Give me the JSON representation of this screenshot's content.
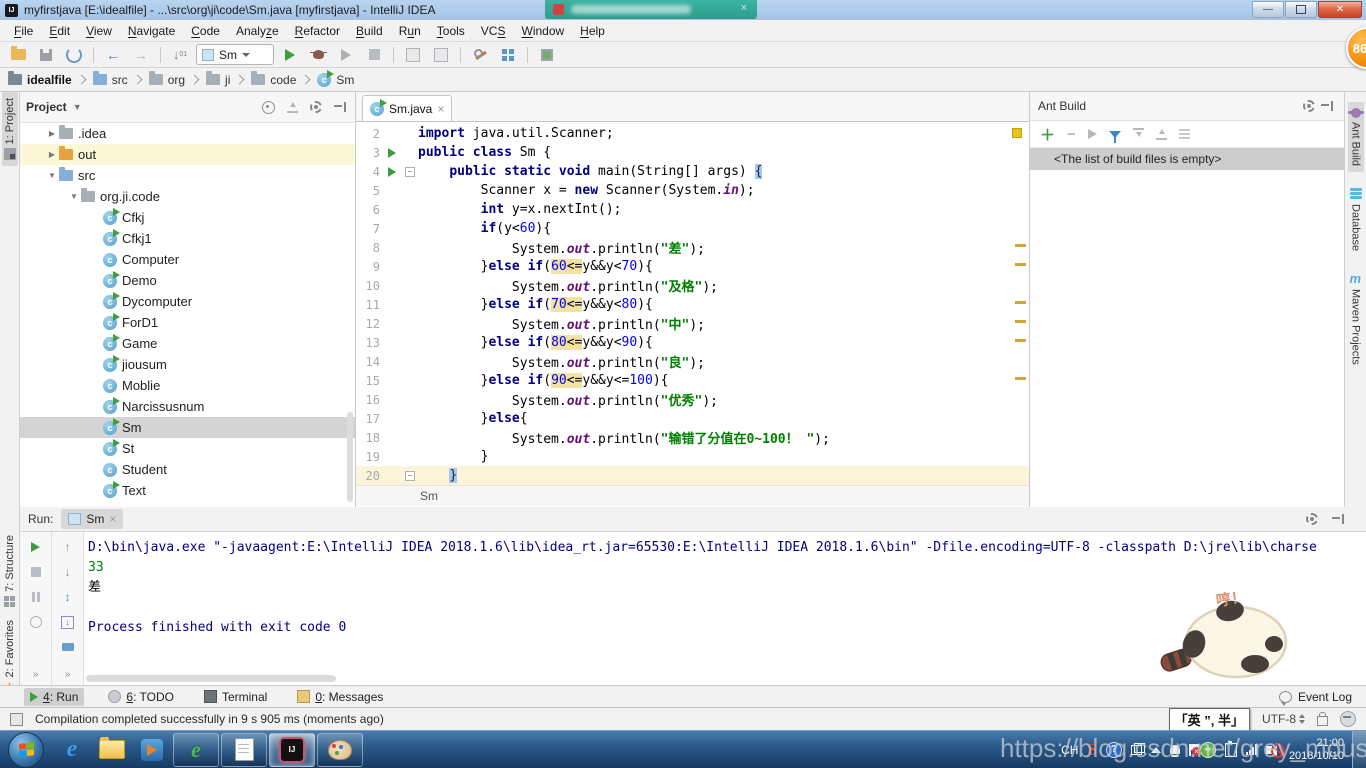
{
  "window": {
    "title": "myfirstjava [E:\\idealfile] - ...\\src\\org\\ji\\code\\Sm.java [myfirstjava] - IntelliJ IDEA",
    "badge": "86"
  },
  "menu": {
    "items": [
      {
        "label": "File",
        "m": 0
      },
      {
        "label": "Edit",
        "m": 0
      },
      {
        "label": "View",
        "m": 0
      },
      {
        "label": "Navigate",
        "m": 0
      },
      {
        "label": "Code",
        "m": 0
      },
      {
        "label": "Analyze",
        "m": 5
      },
      {
        "label": "Refactor",
        "m": 0
      },
      {
        "label": "Build",
        "m": 0
      },
      {
        "label": "Run",
        "m": 1
      },
      {
        "label": "Tools",
        "m": 0
      },
      {
        "label": "VCS",
        "m": 2
      },
      {
        "label": "Window",
        "m": 0
      },
      {
        "label": "Help",
        "m": 0
      }
    ]
  },
  "toolbar": {
    "run_config": "Sm"
  },
  "breadcrumbs": {
    "items": [
      {
        "label": "idealfile",
        "icon": "module"
      },
      {
        "label": "src",
        "icon": "folder-blue"
      },
      {
        "label": "org",
        "icon": "folder-gray"
      },
      {
        "label": "ji",
        "icon": "folder-gray"
      },
      {
        "label": "code",
        "icon": "folder-gray"
      },
      {
        "label": "Sm",
        "icon": "class"
      }
    ]
  },
  "left_strip": {
    "tabs": [
      {
        "label": "1: Project",
        "icon": "project",
        "selected": true
      },
      {
        "label": "7: Structure",
        "icon": "structure",
        "selected": false
      },
      {
        "label": "2: Favorites",
        "icon": "favorites",
        "selected": false
      }
    ]
  },
  "right_strip": {
    "tabs": [
      {
        "label": "Ant Build",
        "icon": "ant",
        "selected": true
      },
      {
        "label": "Database",
        "icon": "database",
        "selected": false
      },
      {
        "label": "Maven Projects",
        "icon": "maven",
        "selected": false
      }
    ]
  },
  "project_panel": {
    "title": "Project",
    "tree": [
      {
        "label": ".idea",
        "type": "folder",
        "color": "gray",
        "arrow": "right",
        "indent": 1
      },
      {
        "label": "out",
        "type": "folder",
        "color": "orange",
        "arrow": "right",
        "indent": 1,
        "highlight": true
      },
      {
        "label": "src",
        "type": "folder",
        "color": "blue",
        "arrow": "down",
        "indent": 1
      },
      {
        "label": "org.ji.code",
        "type": "folder",
        "color": "gray",
        "arrow": "down",
        "indent": 2
      },
      {
        "label": "Cfkj",
        "type": "class",
        "run": true,
        "indent": 3
      },
      {
        "label": "Cfkj1",
        "type": "class",
        "run": true,
        "indent": 3
      },
      {
        "label": "Computer",
        "type": "class",
        "run": false,
        "indent": 3
      },
      {
        "label": "Demo",
        "type": "class",
        "run": true,
        "indent": 3
      },
      {
        "label": "Dycomputer",
        "type": "class",
        "run": true,
        "indent": 3
      },
      {
        "label": "ForD1",
        "type": "class",
        "run": true,
        "indent": 3
      },
      {
        "label": "Game",
        "type": "class",
        "run": true,
        "indent": 3
      },
      {
        "label": "jiousum",
        "type": "class",
        "run": true,
        "indent": 3
      },
      {
        "label": "Moblie",
        "type": "class",
        "run": false,
        "indent": 3
      },
      {
        "label": "Narcissusnum",
        "type": "class",
        "run": true,
        "indent": 3
      },
      {
        "label": "Sm",
        "type": "class",
        "run": true,
        "indent": 3,
        "selected": true
      },
      {
        "label": "St",
        "type": "class",
        "run": true,
        "indent": 3
      },
      {
        "label": "Student",
        "type": "class",
        "run": false,
        "indent": 3
      },
      {
        "label": "Text",
        "type": "class",
        "run": true,
        "indent": 3
      }
    ]
  },
  "editor": {
    "tab": "Sm.java",
    "breadcrumb": "Sm",
    "marks_lines": [
      8,
      9,
      11,
      12,
      13,
      15
    ],
    "lines": [
      {
        "n": 2,
        "seg": [
          [
            "kw",
            "import"
          ],
          [
            "pl",
            " java.util.Scanner;"
          ]
        ]
      },
      {
        "n": 3,
        "run": true,
        "seg": [
          [
            "kw",
            "public class"
          ],
          [
            "pl",
            " Sm {"
          ]
        ]
      },
      {
        "n": 4,
        "run": true,
        "fold": true,
        "seg": [
          [
            "pl",
            "    "
          ],
          [
            "kw",
            "public static void"
          ],
          [
            "pl",
            " main(String[] args) "
          ],
          [
            "brc",
            "{"
          ]
        ]
      },
      {
        "n": 5,
        "seg": [
          [
            "pl",
            "        Scanner x = "
          ],
          [
            "kw",
            "new"
          ],
          [
            "pl",
            " Scanner(System."
          ],
          [
            "fld",
            "in"
          ],
          [
            "pl",
            ");"
          ]
        ]
      },
      {
        "n": 6,
        "seg": [
          [
            "pl",
            "        "
          ],
          [
            "kw",
            "int"
          ],
          [
            "pl",
            " y=x.nextInt();"
          ]
        ]
      },
      {
        "n": 7,
        "seg": [
          [
            "pl",
            "        "
          ],
          [
            "kw",
            "if"
          ],
          [
            "pl",
            "(y<"
          ],
          [
            "num",
            "60"
          ],
          [
            "pl",
            "){"
          ]
        ]
      },
      {
        "n": 8,
        "seg": [
          [
            "pl",
            "            System."
          ],
          [
            "fld",
            "out"
          ],
          [
            "pl",
            ".println("
          ],
          [
            "str",
            "\"差\""
          ],
          [
            "pl",
            ");"
          ]
        ]
      },
      {
        "n": 9,
        "seg": [
          [
            "pl",
            "        }"
          ],
          [
            "kw",
            "else"
          ],
          [
            "pl",
            " "
          ],
          [
            "kw",
            "if"
          ],
          [
            "pl",
            "("
          ],
          [
            "numh",
            "60"
          ],
          [
            "plh",
            "<="
          ],
          [
            "pl",
            "y&&y<"
          ],
          [
            "num",
            "70"
          ],
          [
            "pl",
            "){"
          ]
        ]
      },
      {
        "n": 10,
        "seg": [
          [
            "pl",
            "            System."
          ],
          [
            "fld",
            "out"
          ],
          [
            "pl",
            ".println("
          ],
          [
            "str",
            "\"及格\""
          ],
          [
            "pl",
            ");"
          ]
        ]
      },
      {
        "n": 11,
        "seg": [
          [
            "pl",
            "        }"
          ],
          [
            "kw",
            "else"
          ],
          [
            "pl",
            " "
          ],
          [
            "kw",
            "if"
          ],
          [
            "pl",
            "("
          ],
          [
            "numh",
            "70"
          ],
          [
            "plh",
            "<="
          ],
          [
            "pl",
            "y&&y<"
          ],
          [
            "num",
            "80"
          ],
          [
            "pl",
            "){"
          ]
        ]
      },
      {
        "n": 12,
        "seg": [
          [
            "pl",
            "            System."
          ],
          [
            "fld",
            "out"
          ],
          [
            "pl",
            ".println("
          ],
          [
            "str",
            "\"中\""
          ],
          [
            "pl",
            ");"
          ]
        ]
      },
      {
        "n": 13,
        "seg": [
          [
            "pl",
            "        }"
          ],
          [
            "kw",
            "else"
          ],
          [
            "pl",
            " "
          ],
          [
            "kw",
            "if"
          ],
          [
            "pl",
            "("
          ],
          [
            "numh",
            "80"
          ],
          [
            "plh",
            "<="
          ],
          [
            "pl",
            "y&&y<"
          ],
          [
            "num",
            "90"
          ],
          [
            "pl",
            "){"
          ]
        ]
      },
      {
        "n": 14,
        "seg": [
          [
            "pl",
            "            System."
          ],
          [
            "fld",
            "out"
          ],
          [
            "pl",
            ".println("
          ],
          [
            "str",
            "\"良\""
          ],
          [
            "pl",
            ");"
          ]
        ]
      },
      {
        "n": 15,
        "seg": [
          [
            "pl",
            "        }"
          ],
          [
            "kw",
            "else"
          ],
          [
            "pl",
            " "
          ],
          [
            "kw",
            "if"
          ],
          [
            "pl",
            "("
          ],
          [
            "numh",
            "90"
          ],
          [
            "plh",
            "<="
          ],
          [
            "pl",
            "y&&y<="
          ],
          [
            "num",
            "100"
          ],
          [
            "pl",
            "){"
          ]
        ]
      },
      {
        "n": 16,
        "seg": [
          [
            "pl",
            "            System."
          ],
          [
            "fld",
            "out"
          ],
          [
            "pl",
            ".println("
          ],
          [
            "str",
            "\"优秀\""
          ],
          [
            "pl",
            ");"
          ]
        ]
      },
      {
        "n": 17,
        "seg": [
          [
            "pl",
            "        }"
          ],
          [
            "kw",
            "else"
          ],
          [
            "pl",
            "{"
          ]
        ]
      },
      {
        "n": 18,
        "seg": [
          [
            "pl",
            "            System."
          ],
          [
            "fld",
            "out"
          ],
          [
            "pl",
            ".println("
          ],
          [
            "str",
            "\"输错了分值在0~100！ \""
          ],
          [
            "pl",
            ");"
          ]
        ]
      },
      {
        "n": 19,
        "seg": [
          [
            "pl",
            "        }"
          ]
        ]
      },
      {
        "n": 20,
        "cur": true,
        "fold": true,
        "seg": [
          [
            "pl",
            "    "
          ],
          [
            "brc",
            "}"
          ]
        ]
      }
    ]
  },
  "ant_panel": {
    "title": "Ant Build",
    "empty_text": "<The list of build files is empty>"
  },
  "run_panel": {
    "label": "Run:",
    "tab": "Sm",
    "console": [
      {
        "style": "sys",
        "text": "D:\\bin\\java.exe \"-javaagent:E:\\IntelliJ IDEA 2018.1.6\\lib\\idea_rt.jar=65530:E:\\IntelliJ IDEA 2018.1.6\\bin\" -Dfile.encoding=UTF-8 -classpath D:\\jre\\lib\\charse"
      },
      {
        "style": "input",
        "text": "33"
      },
      {
        "style": "stdout",
        "text": "差"
      },
      {
        "style": "stdout",
        "text": ""
      },
      {
        "style": "sys",
        "text": "Process finished with exit code 0"
      }
    ],
    "sticker_text": "哼！"
  },
  "bottom_bar": {
    "items": [
      {
        "label": "4: Run",
        "icon": "run",
        "m": 0,
        "selected": true
      },
      {
        "label": "6: TODO",
        "icon": "todo",
        "m": 0,
        "selected": false
      },
      {
        "label": "Terminal",
        "icon": "terminal",
        "selected": false
      },
      {
        "label": "0: Messages",
        "icon": "messages",
        "m": 0,
        "selected": false
      }
    ],
    "event_log": "Event Log"
  },
  "status_bar": {
    "message": "Compilation completed successfully in 9 s 905 ms (moments ago)",
    "ime": "「英 ”, 半」",
    "encoding": "UTF-8"
  },
  "taskbar": {
    "tray_lang": "CH",
    "time": "21:00",
    "date": "2018/10/10",
    "watermark": "https://blog.csdn.net/grey_mouse"
  }
}
